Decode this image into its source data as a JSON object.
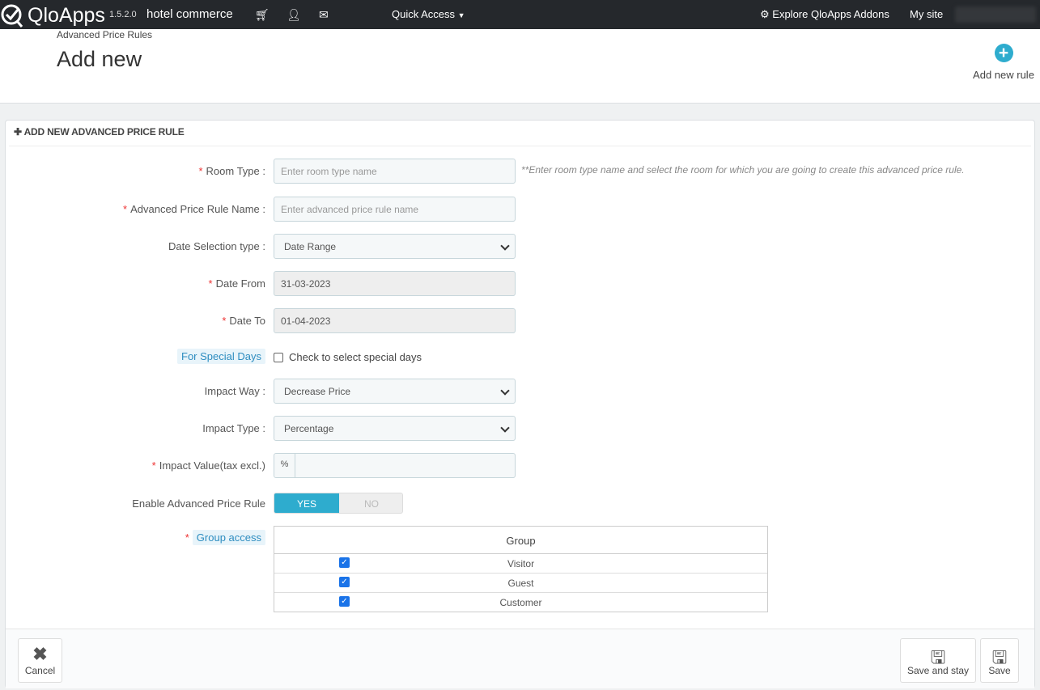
{
  "topbar": {
    "brand": "QloApps",
    "version": "1.5.2.0",
    "shop_name": "hotel commerce",
    "quick_access": "Quick Access",
    "explore": "Explore QloApps Addons",
    "my_site": "My site"
  },
  "header": {
    "breadcrumb": "Advanced Price Rules",
    "title": "Add new",
    "add_new_rule": "Add new rule"
  },
  "panel": {
    "title": "ADD NEW ADVANCED PRICE RULE",
    "room_type": {
      "label": "Room Type :",
      "placeholder": "Enter room type name",
      "hint": "**Enter room type name and select the room for which you are going to create this advanced price rule."
    },
    "rule_name": {
      "label": "Advanced Price Rule Name :",
      "placeholder": "Enter advanced price rule name"
    },
    "date_selection": {
      "label": "Date Selection type :",
      "value": "Date Range"
    },
    "date_from": {
      "label": "Date From",
      "value": "31-03-2023"
    },
    "date_to": {
      "label": "Date To",
      "value": "01-04-2023"
    },
    "special_days": {
      "label": "For Special Days",
      "checkbox_label": "Check to select special days",
      "checked": false
    },
    "impact_way": {
      "label": "Impact Way :",
      "value": "Decrease Price"
    },
    "impact_type": {
      "label": "Impact Type :",
      "value": "Percentage"
    },
    "impact_value": {
      "label": "Impact Value(tax excl.)",
      "prefix": "%",
      "value": ""
    },
    "enable": {
      "label": "Enable Advanced Price Rule",
      "yes": "YES",
      "no": "NO",
      "selected": "YES"
    },
    "group_access": {
      "label": "Group access",
      "header": "Group",
      "groups": [
        {
          "name": "Visitor",
          "checked": true
        },
        {
          "name": "Guest",
          "checked": true
        },
        {
          "name": "Customer",
          "checked": true
        }
      ]
    },
    "required_mark": "*"
  },
  "footer": {
    "cancel": "Cancel",
    "save_and_stay": "Save and stay",
    "save": "Save"
  },
  "colors": {
    "accent": "#2eacce",
    "topbar": "#25282c",
    "required": "#e33333"
  }
}
